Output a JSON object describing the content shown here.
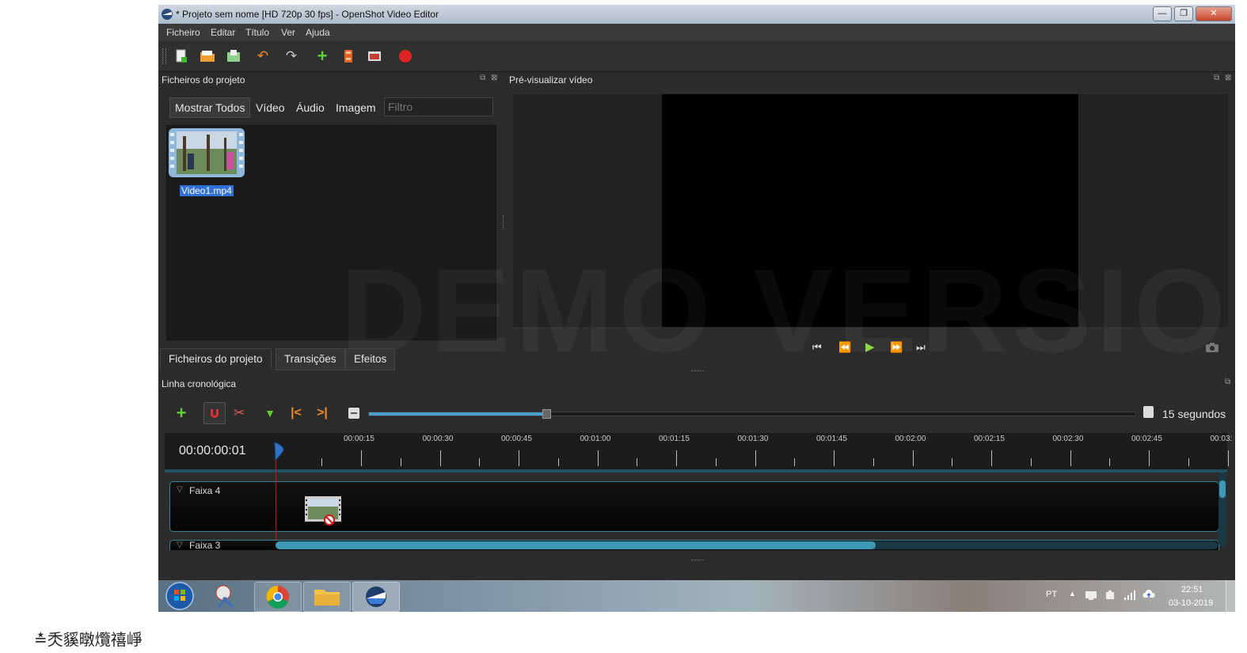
{
  "window": {
    "title": "* Projeto sem nome [HD 720p 30 fps] - OpenShot Video Editor",
    "minimize": "—",
    "maximize": "❐",
    "close": "✕"
  },
  "menu": [
    "Ficheiro",
    "Editar",
    "Título",
    "Ver",
    "Ajuda"
  ],
  "toolbar_icons": [
    "new-project-icon",
    "open-project-icon",
    "save-project-icon",
    "undo-icon",
    "redo-icon",
    "import-files-icon",
    "choose-profile-icon",
    "fullscreen-icon",
    "export-video-icon"
  ],
  "project_files": {
    "header": "Ficheiros do projeto",
    "filters": [
      "Mostrar Todos",
      "Vídeo",
      "Áudio",
      "Imagem"
    ],
    "filter_placeholder": "Filtro",
    "files": [
      {
        "name": "Video1.mp4"
      }
    ]
  },
  "preview": {
    "header": "Pré-visualizar vídeo"
  },
  "bottom_tabs": [
    "Ficheiros do projeto",
    "Transições",
    "Efeitos"
  ],
  "timeline": {
    "header": "Linha cronológica",
    "current_time": "00:00:00:01",
    "zoom_label": "15 segundos",
    "zoom_level": 0.23,
    "ruler_labels": [
      "00:00:15",
      "00:00:30",
      "00:00:45",
      "00:01:00",
      "00:01:15",
      "00:01:30",
      "00:01:45",
      "00:02:00",
      "00:02:15",
      "00:02:30",
      "00:02:45",
      "00:03:"
    ],
    "tracks": [
      {
        "name": "Faixa 4"
      },
      {
        "name": "Faixa 3"
      }
    ]
  },
  "watermark": "DEMO VERSION",
  "taskbar": {
    "language": "PT",
    "time": "22:51",
    "date": "03-10-2019"
  },
  "colors": {
    "accent": "#3a7e97",
    "selection": "#2f6fd6",
    "playhead": "#c8102e"
  }
}
